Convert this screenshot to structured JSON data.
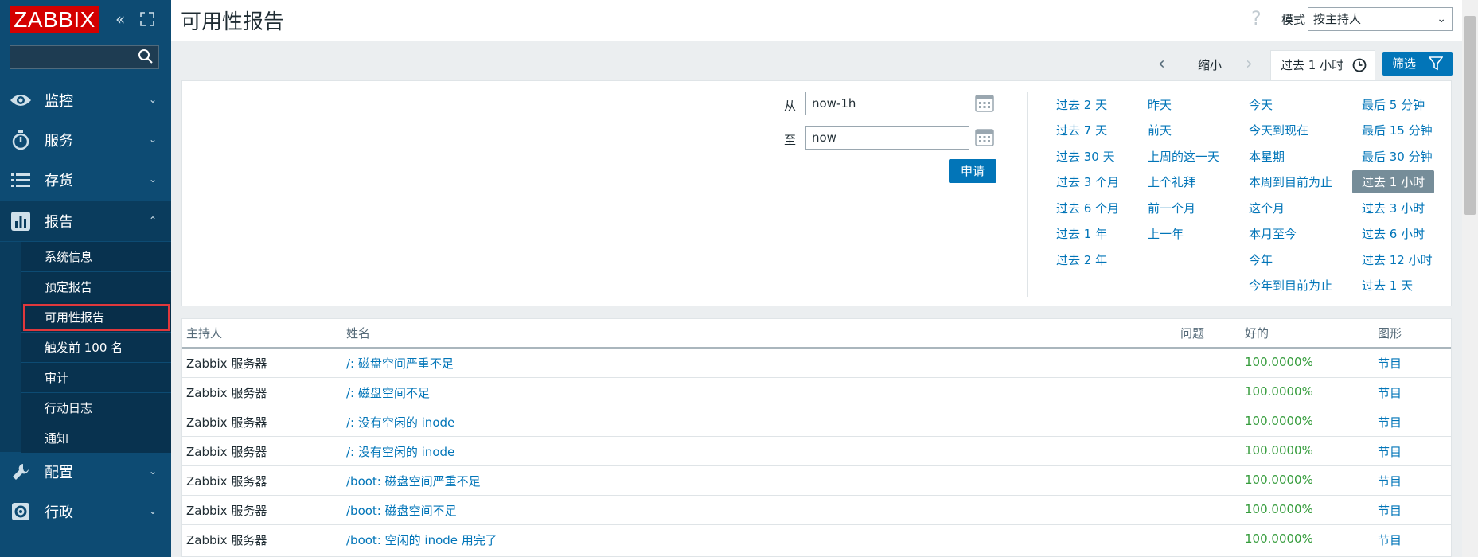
{
  "sidebar": {
    "logo": "ZABBIX",
    "menu": [
      {
        "label": "监控",
        "icon": "eye-icon"
      },
      {
        "label": "服务",
        "icon": "stopwatch-icon"
      },
      {
        "label": "存货",
        "icon": "list-icon"
      },
      {
        "label": "报告",
        "icon": "bar-chart-icon"
      },
      {
        "label": "配置",
        "icon": "wrench-icon"
      },
      {
        "label": "行政",
        "icon": "gear-icon"
      }
    ],
    "reports_sub": [
      "系统信息",
      "预定报告",
      "可用性报告",
      "触发前 100 名",
      "审计",
      "行动日志",
      "通知"
    ]
  },
  "header": {
    "title": "可用性报告",
    "help": "?",
    "mode_label": "模式",
    "mode_value": "按主持人"
  },
  "tabs": {
    "zoom_out": "缩小",
    "time_range": "过去 1 小时",
    "filter": "筛选"
  },
  "filter": {
    "from_label": "从",
    "from_value": "now-1h",
    "to_label": "至",
    "to_value": "now",
    "apply": "申请",
    "quick": {
      "col1": [
        "过去 2 天",
        "过去 7 天",
        "过去 30 天",
        "过去 3 个月",
        "过去 6 个月",
        "过去 1 年",
        "过去 2 年"
      ],
      "col2": [
        "昨天",
        "前天",
        "上周的这一天",
        "上个礼拜",
        "前一个月",
        "上一年"
      ],
      "col3": [
        "今天",
        "今天到现在",
        "本星期",
        "本周到目前为止",
        "这个月",
        "本月至今",
        "今年",
        "今年到目前为止"
      ],
      "col4": [
        "最后 5 分钟",
        "最后 15 分钟",
        "最后 30 分钟",
        "过去 1 小时",
        "过去 3 小时",
        "过去 6 小时",
        "过去 12 小时",
        "过去 1 天"
      ]
    },
    "selected": "过去 1 小时"
  },
  "table": {
    "headers": {
      "host": "主持人",
      "name": "姓名",
      "problem": "问题",
      "ok": "好的",
      "graph": "图形"
    },
    "rows": [
      {
        "host": "Zabbix 服务器",
        "name": "/:  磁盘空间严重不足",
        "ok": "100.0000%",
        "graph": "节目"
      },
      {
        "host": "Zabbix 服务器",
        "name": "/:  磁盘空间不足",
        "ok": "100.0000%",
        "graph": "节目"
      },
      {
        "host": "Zabbix 服务器",
        "name": "/: 没有空闲的 inode",
        "ok": "100.0000%",
        "graph": "节目"
      },
      {
        "host": "Zabbix 服务器",
        "name": "/: 没有空闲的 inode",
        "ok": "100.0000%",
        "graph": "节目"
      },
      {
        "host": "Zabbix 服务器",
        "name": "/boot:  磁盘空间严重不足",
        "ok": "100.0000%",
        "graph": "节目"
      },
      {
        "host": "Zabbix 服务器",
        "name": "/boot:  磁盘空间不足",
        "ok": "100.0000%",
        "graph": "节目"
      },
      {
        "host": "Zabbix 服务器",
        "name": "/boot:  空闲的 inode 用完了",
        "ok": "100.0000%",
        "graph": "节目"
      }
    ]
  }
}
